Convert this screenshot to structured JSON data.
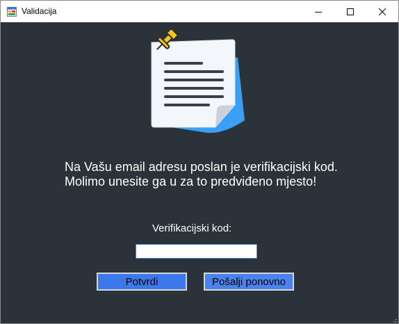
{
  "window": {
    "title": "Validacija",
    "controls": {
      "minimize": "minimize-icon",
      "maximize": "maximize-icon",
      "close": "close-icon"
    }
  },
  "message": {
    "line1": "Na Vašu email adresu poslan je verifikacijski kod.",
    "line2": "Molimo unesite ga u za to predviđeno mjesto!"
  },
  "form": {
    "code_label": "Verifikacijski kod:",
    "code_value": "",
    "confirm_label": "Potvrdi",
    "resend_label": "Pošalji ponovno"
  },
  "colors": {
    "background": "#2b3238",
    "button": "#3b78ec",
    "paper_blue": "#3aa0f5",
    "pin": "#f5c518"
  },
  "icons": {
    "illustration": "notepad-pin-icon",
    "app": "form-app-icon",
    "grip": "resize-grip-icon"
  }
}
